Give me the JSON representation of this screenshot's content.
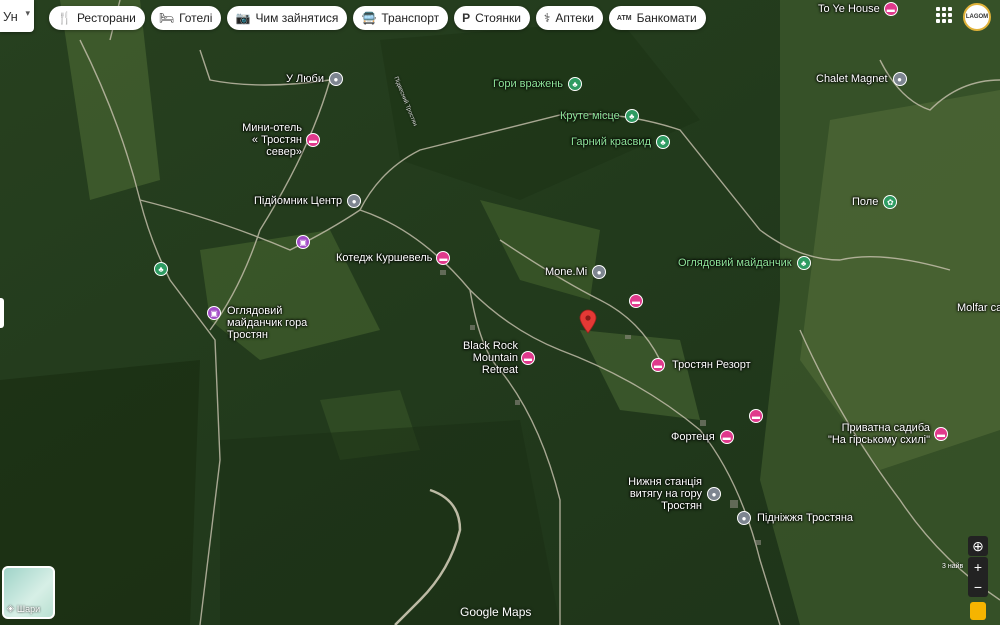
{
  "search": {
    "text": "Ун"
  },
  "chips": [
    {
      "icon": "restaurant-icon",
      "glyph": "🍴",
      "label": "Ресторани"
    },
    {
      "icon": "hotel-icon",
      "glyph": "🛏",
      "label": "Готелі"
    },
    {
      "icon": "camera-icon",
      "glyph": "📷",
      "label": "Чим зайнятися"
    },
    {
      "icon": "transit-icon",
      "glyph": "🚍",
      "label": "Транспорт"
    },
    {
      "icon": "parking-icon",
      "glyph": "P",
      "label": "Стоянки"
    },
    {
      "icon": "pharmacy-icon",
      "glyph": "⚕",
      "label": "Аптеки"
    },
    {
      "icon": "atm-icon",
      "glyph": "ATM",
      "label": "Банкомати"
    }
  ],
  "account": {
    "avatar_text": "LAGOM"
  },
  "places": [
    {
      "name": "to-ye-house",
      "label": "To Ye House",
      "type": "pink"
    },
    {
      "name": "chalet-magnet",
      "label": "Chalet Magnet",
      "type": "gray"
    },
    {
      "name": "u-lyuby",
      "label": "У Люби",
      "type": "gray"
    },
    {
      "name": "hory-vrazhen",
      "label": "Гори вражень",
      "type": "green"
    },
    {
      "name": "kryte-mistse",
      "label": "Круте місце",
      "type": "green"
    },
    {
      "name": "harnyi-krasvyd",
      "label": "Гарний красвид",
      "type": "green"
    },
    {
      "name": "mini-hotel",
      "label": "Мини-отель « Тростян север»",
      "type": "pink"
    },
    {
      "name": "pole",
      "label": "Поле",
      "type": "green"
    },
    {
      "name": "pidiomnyk-tsentr",
      "label": "Підйомник Центр",
      "type": "gray"
    },
    {
      "name": "kotedzh-kurshevel",
      "label": "Котедж Куршевель",
      "type": "pink"
    },
    {
      "name": "mone-mi",
      "label": "Mone.Mi",
      "type": "gray"
    },
    {
      "name": "ohliadovyi-maidanchyk-east",
      "label": "Оглядовий майданчик",
      "type": "green"
    },
    {
      "name": "molfar",
      "label": "Molfar cal",
      "type": "none"
    },
    {
      "name": "ohliadovyi-maidanchyk-trostian",
      "label": "Оглядовий майданчик гора Тростян",
      "type": "purple"
    },
    {
      "name": "black-rock",
      "label": "Black Rock Mountain Retreat",
      "type": "pink"
    },
    {
      "name": "trostian-resort",
      "label": "Тростян Резорт",
      "type": "pink"
    },
    {
      "name": "fortetsia",
      "label": "Фортеця",
      "type": "pink"
    },
    {
      "name": "pryvatna-sadyba",
      "label": "Приватна садиба \"На гірському схилі\"",
      "type": "pink"
    },
    {
      "name": "nyzhnia-stantsiia",
      "label": "Нижня станція витягу на гору Тростян",
      "type": "gray"
    },
    {
      "name": "pidnizhzhia-trostiana",
      "label": "Підніжжя Тростяна",
      "type": "gray"
    }
  ],
  "road_label": "Підвесний Тростян",
  "layers": {
    "label": "Шари"
  },
  "attribution": {
    "google": "Google",
    "maps": "Maps"
  },
  "scale_note": "3 найв",
  "colors": {
    "selected_pin": "#e53935"
  }
}
